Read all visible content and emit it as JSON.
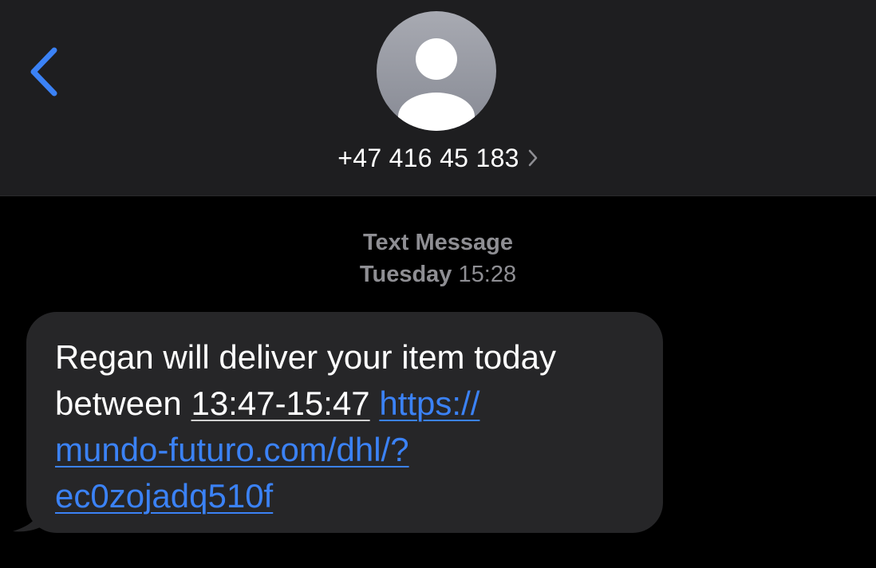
{
  "header": {
    "back_icon": "chevron-left-icon",
    "avatar_icon": "person-silhouette-icon",
    "contact_name": "+47 416 45 183",
    "contact_chevron_icon": "chevron-right-icon"
  },
  "thread": {
    "service_label": "Text Message",
    "day": "Tuesday",
    "time": "15:28"
  },
  "message": {
    "line1": "Regan will deliver your item today",
    "line2_prefix": "between ",
    "time_range": "13:47-15:47",
    "url_part1": "https://",
    "url_part2": "mundo-futuro.com/dhl/?",
    "url_part3": "ec0zojadq510f"
  },
  "colors": {
    "accent": "#3b82f6",
    "header_bg": "#1e1e20",
    "bubble_bg": "#262628",
    "background": "#000000",
    "secondary_text": "#8e8e93"
  }
}
